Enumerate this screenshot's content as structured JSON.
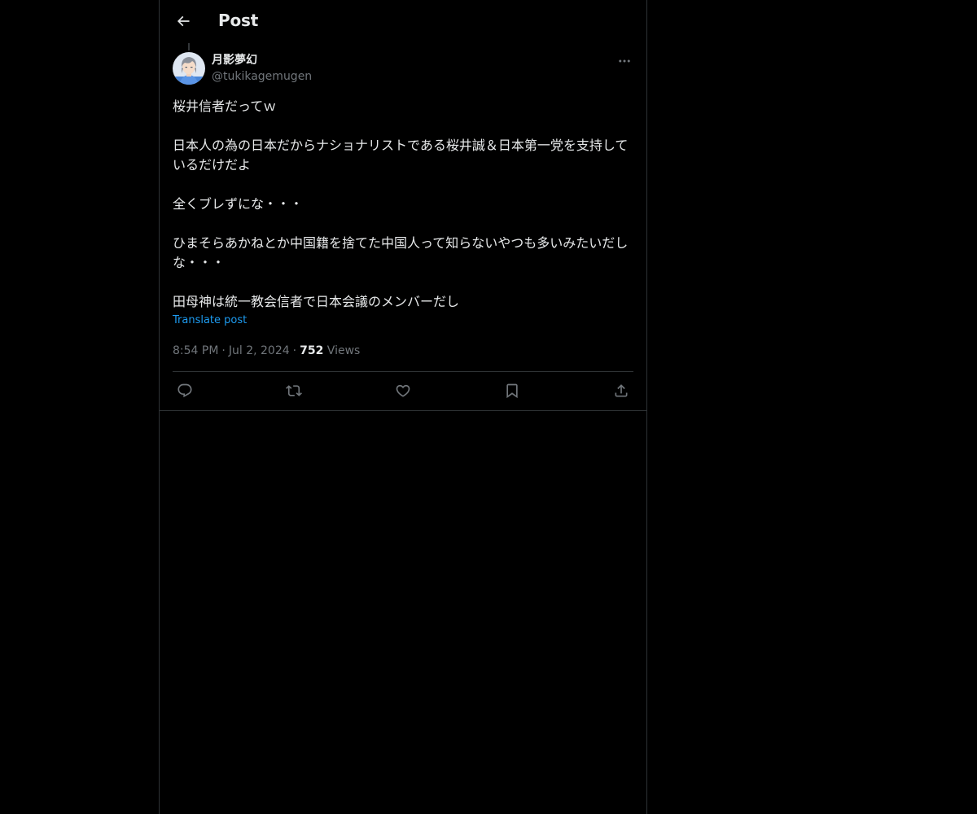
{
  "header": {
    "title": "Post",
    "back_icon": "arrow-left-icon"
  },
  "author": {
    "display_name": "月影夢幻",
    "handle": "@tukikagemugen",
    "avatar_icon": "anime-avatar"
  },
  "post": {
    "text": "桜井信者だってｗ\n\n日本人の為の日本だからナショナリストである桜井誠＆日本第一党を支持しているだけだよ\n\n全くブレずにな・・・\n\nひまそらあかねとか中国籍を捨てた中国人って知らないやつも多いみたいだしな・・・\n\n田母神は統一教会信者で日本会議のメンバーだし",
    "translate_label": "Translate post",
    "time": "8:54 PM",
    "separator": "·",
    "date": "Jul 2, 2024",
    "views_count": "752",
    "views_label": "Views"
  },
  "actions": [
    {
      "name": "reply",
      "icon": "reply-icon"
    },
    {
      "name": "repost",
      "icon": "repost-icon"
    },
    {
      "name": "like",
      "icon": "heart-icon"
    },
    {
      "name": "bookmark",
      "icon": "bookmark-icon"
    },
    {
      "name": "share",
      "icon": "share-icon"
    }
  ],
  "colors": {
    "background": "#000000",
    "text": "#e7e9ea",
    "secondary_text": "#71767b",
    "link": "#1d9bf0",
    "border": "#2f3336"
  }
}
